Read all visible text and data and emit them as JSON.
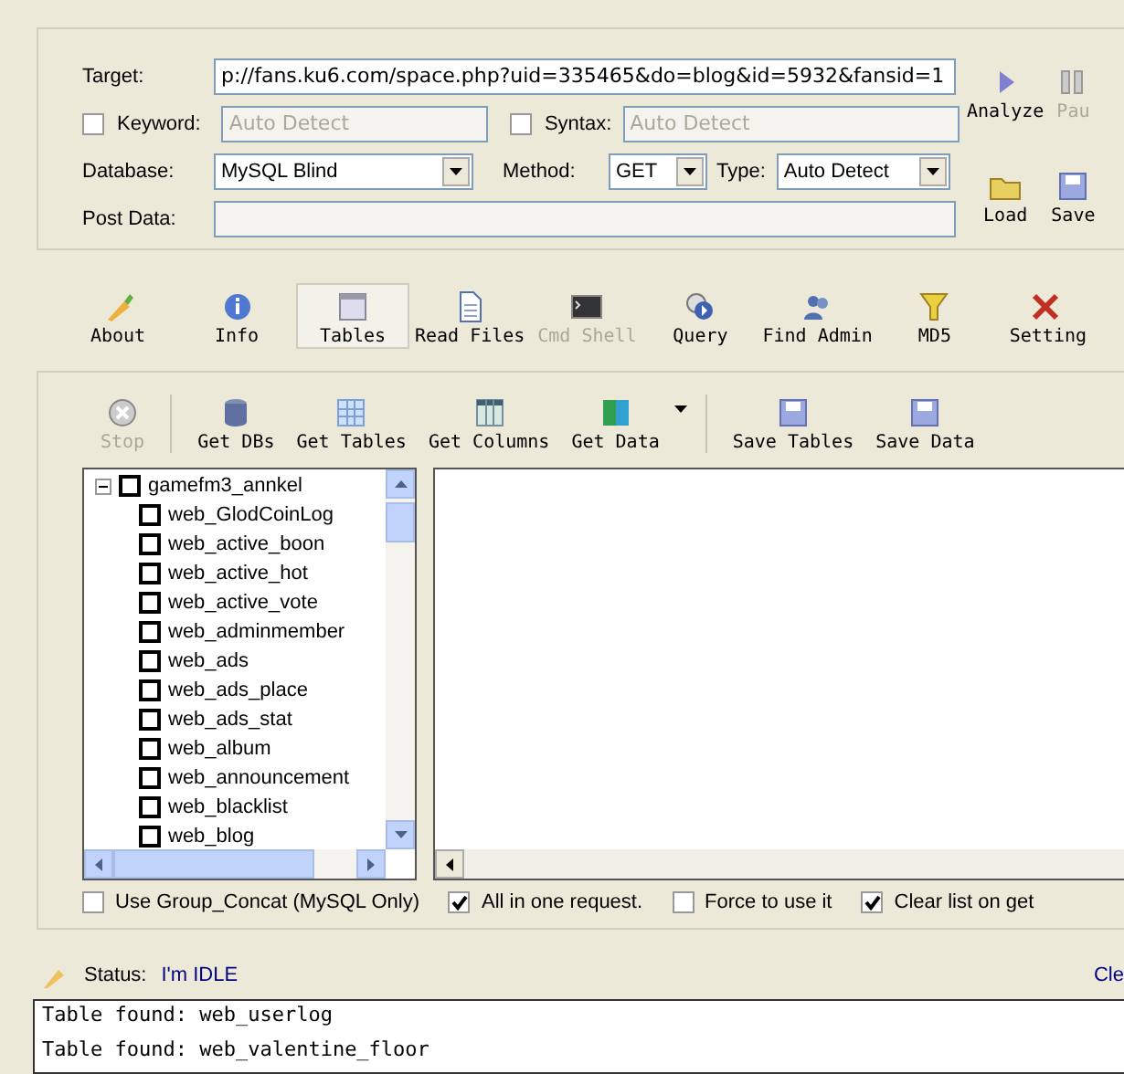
{
  "target_form": {
    "target_label": "Target:",
    "target_value": "p://fans.ku6.com/space.php?uid=335465&do=blog&id=5932&fansid=1",
    "keyword": {
      "label": "Keyword:",
      "checked": false,
      "placeholder": "Auto Detect"
    },
    "syntax": {
      "label": "Syntax:",
      "checked": false,
      "placeholder": "Auto Detect"
    },
    "database_label": "Database:",
    "database_value": "MySQL Blind",
    "method_label": "Method:",
    "method_value": "GET",
    "type_label": "Type:",
    "type_value": "Auto Detect",
    "post_data_label": "Post Data:"
  },
  "side_buttons": [
    {
      "label": "Analyze",
      "kind": "play",
      "disabled": false
    },
    {
      "label": "Pau",
      "kind": "pause",
      "disabled": true
    },
    {
      "label": "Load",
      "kind": "folder",
      "disabled": false
    },
    {
      "label": "Save",
      "kind": "disk",
      "disabled": false
    }
  ],
  "tabs": [
    {
      "label": "About",
      "kind": "about",
      "selected": false,
      "disabled": false
    },
    {
      "label": "Info",
      "kind": "info",
      "selected": false,
      "disabled": false
    },
    {
      "label": "Tables",
      "kind": "tables",
      "selected": true,
      "disabled": false
    },
    {
      "label": "Read Files",
      "kind": "file",
      "selected": false,
      "disabled": false
    },
    {
      "label": "Cmd Shell",
      "kind": "shell",
      "selected": false,
      "disabled": true
    },
    {
      "label": "Query",
      "kind": "query",
      "selected": false,
      "disabled": false
    },
    {
      "label": "Find Admin",
      "kind": "admin",
      "selected": false,
      "disabled": false
    },
    {
      "label": "MD5",
      "kind": "md5",
      "selected": false,
      "disabled": false
    },
    {
      "label": "Setting",
      "kind": "setting",
      "selected": false,
      "disabled": false
    }
  ],
  "toolbar": [
    {
      "label": "Stop",
      "kind": "stop",
      "disabled": true
    },
    {
      "kind": "separator"
    },
    {
      "label": "Get DBs",
      "kind": "db",
      "disabled": false
    },
    {
      "label": "Get Tables",
      "kind": "grid",
      "disabled": false
    },
    {
      "label": "Get Columns",
      "kind": "columns",
      "disabled": false
    },
    {
      "label": "Get Data",
      "kind": "data",
      "disabled": false
    },
    {
      "kind": "dropdown"
    },
    {
      "kind": "separator"
    },
    {
      "label": "Save Tables",
      "kind": "disk",
      "disabled": false
    },
    {
      "label": "Save Data",
      "kind": "disk",
      "disabled": false
    }
  ],
  "tree": {
    "name": "gamefm3_annkel",
    "expanded": true,
    "checked": false,
    "children": [
      {
        "name": "web_GlodCoinLog",
        "checked": false
      },
      {
        "name": "web_active_boon",
        "checked": false
      },
      {
        "name": "web_active_hot",
        "checked": false
      },
      {
        "name": "web_active_vote",
        "checked": false
      },
      {
        "name": "web_adminmember",
        "checked": false
      },
      {
        "name": "web_ads",
        "checked": false
      },
      {
        "name": "web_ads_place",
        "checked": false
      },
      {
        "name": "web_ads_stat",
        "checked": false
      },
      {
        "name": "web_album",
        "checked": false
      },
      {
        "name": "web_announcement",
        "checked": false
      },
      {
        "name": "web_blacklist",
        "checked": false
      },
      {
        "name": "web_blog",
        "checked": false
      }
    ]
  },
  "options": [
    {
      "label": "Use Group_Concat (MySQL Only)",
      "checked": false
    },
    {
      "label": "All in one request.",
      "checked": true
    },
    {
      "label": "Force to use it",
      "checked": false
    },
    {
      "label": "Clear list on get",
      "checked": true
    }
  ],
  "status": {
    "label": "Status:",
    "value": "I'm IDLE",
    "clear_link": "Cle"
  },
  "log": [
    "Table found: web_userlog",
    "Table found: web_valentine_floor"
  ]
}
